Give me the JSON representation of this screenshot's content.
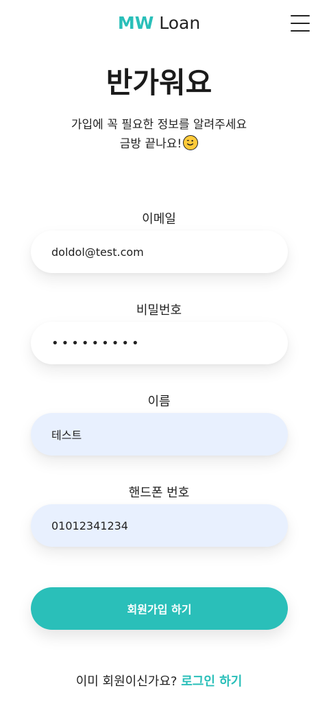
{
  "header": {
    "brand": "MW",
    "brand_rest": "Loan",
    "menu_icon": "hamburger-menu-icon"
  },
  "title": "반가워요",
  "subtitle_line1": "가입에 꼭 필요한 정보를 알려주세요",
  "subtitle_line2": "금방 끝나요!",
  "subtitle_emoji": "winking-face-icon",
  "form": {
    "email_label": "이메일",
    "email_value": "doldol@test.com",
    "password_label": "비밀번호",
    "password_value": "•••••••••",
    "name_label": "이름",
    "name_value": "테스트",
    "phone_label": "핸드폰 번호",
    "phone_value": "01012341234"
  },
  "submit_label": "회원가입 하기",
  "footer": {
    "question": "이미 회원이신가요?",
    "login_label": "로그인 하기"
  },
  "colors": {
    "accent": "#2ABFB9",
    "autofill_bg": "#E8F0FE",
    "text": "#222222"
  }
}
